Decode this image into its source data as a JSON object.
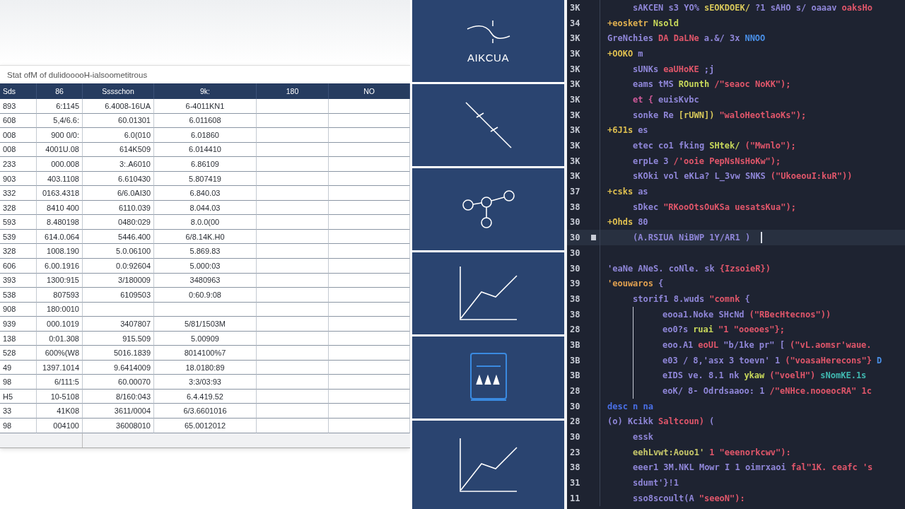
{
  "spreadsheet": {
    "title": "Stat ofM of dulidooooH-ialsoometitrous",
    "columns": [
      "Sds",
      "86",
      "Sssschon",
      "9k:",
      "180",
      "NO"
    ],
    "rows": [
      {
        "cells": [
          "893",
          "6:1145",
          "6.4008-16UA",
          "6-4011KN1"
        ]
      },
      {
        "cells": [
          "608",
          "5,4/6.6:",
          "60.01301",
          "6.011608"
        ]
      },
      {
        "cells": [
          "008",
          "900 0/0:",
          "6.0(010",
          "6.01860"
        ]
      },
      {
        "cells": [
          "008",
          "4001U.08",
          "614K509",
          "6.014410"
        ]
      },
      {
        "cells": [
          "233",
          "000.008",
          "3:.A6010",
          "6.86109"
        ]
      },
      {
        "cells": [
          "903",
          "403.1108",
          "6.610430",
          "5.807419"
        ]
      },
      {
        "cells": [
          "332",
          "0163.4318",
          "6/6.0AI30",
          "6.840.03"
        ]
      },
      {
        "cells": [
          "328",
          "8410 400",
          "6110.039",
          "8.044.03"
        ]
      },
      {
        "cells": [
          "593",
          "8.480198",
          "0480:029",
          "8.0.0(00"
        ]
      },
      {
        "cells": [
          "539",
          "614.0.064",
          "5446.400",
          "6/8.14K.H0"
        ]
      },
      {
        "cells": [
          "328",
          "1008.190",
          "5.0.06100",
          "5.869.83"
        ]
      },
      {
        "cells": [
          "606",
          "6.00.1916",
          "0.0:92604",
          "5.000:03"
        ]
      },
      {
        "cells": [
          "393",
          "1300:915",
          "3/180009",
          "3480963"
        ]
      },
      {
        "cells": [
          "538",
          "807593",
          "6109503",
          "0:60.9:08"
        ]
      },
      {
        "cells": [
          "908",
          "180:0010"
        ]
      },
      {
        "cells": [
          "939",
          "000.1019",
          "3407807",
          "5/81/1503M"
        ]
      },
      {
        "cells": [
          "138",
          "0:01.308",
          "915.509",
          "5.00909"
        ]
      },
      {
        "cells": [
          "528",
          "600%(W8",
          "5016.1839",
          "8014100%7"
        ]
      },
      {
        "cells": [
          "49",
          "1397.1014",
          "9.6414009",
          "18.0180:89"
        ]
      },
      {
        "cells": [
          "98",
          "6/111:5",
          "60.00070",
          "3:3/03:93"
        ]
      },
      {
        "cells": [
          "H5",
          "10-5108",
          "8/160:043",
          "6.4.419.52"
        ]
      },
      {
        "cells": [
          "33",
          "41K08",
          "3611/0004",
          "6/3.6601016"
        ]
      },
      {
        "cells": [
          "98",
          "004100",
          "36008010",
          "65.0012012"
        ]
      }
    ]
  },
  "tiles": [
    {
      "kind": "wave",
      "label": "AIKCUA"
    },
    {
      "kind": "ruler"
    },
    {
      "kind": "nodes"
    },
    {
      "kind": "chart"
    },
    {
      "kind": "server"
    },
    {
      "kind": "chart"
    }
  ],
  "editor": {
    "lines": [
      {
        "number": "3K",
        "kind": "block",
        "current": false,
        "tokens": [
          {
            "text": "sAKCEN s3 YO%",
            "color": "#8f86d8"
          },
          {
            "text": "sEOKDOEK/",
            "color": "#d8c85a"
          },
          {
            "text": "?1 sAHO s/ oaaav",
            "color": "#8f86d8"
          },
          {
            "text": "oaksHo",
            "color": "#e0566a"
          }
        ]
      },
      {
        "number": "34",
        "kind": "root",
        "current": false,
        "tokens": [
          {
            "text": "+eosketr",
            "color": "#e0b050"
          },
          {
            "text": "Nsold",
            "color": "#c8d85a"
          }
        ]
      },
      {
        "number": "3K",
        "kind": "root",
        "current": false,
        "tokens": [
          {
            "text": "GreNchies",
            "color": "#8f86d8"
          },
          {
            "text": "DA DaLNe",
            "color": "#e0566a"
          },
          {
            "text": "a.&/ 3x",
            "color": "#8f86d8"
          },
          {
            "text": "NNOO",
            "color": "#4a90e8"
          }
        ]
      },
      {
        "number": "3K",
        "kind": "root",
        "current": false,
        "tokens": [
          {
            "text": "+OOKO",
            "color": "#e0c050"
          },
          {
            "text": "m",
            "color": "#8f86d8"
          }
        ]
      },
      {
        "number": "3K",
        "kind": "block",
        "current": false,
        "tokens": [
          {
            "text": "sUNKs",
            "color": "#8f86d8"
          },
          {
            "text": "eaUHoKE",
            "color": "#e0566a"
          },
          {
            "text": ";j",
            "color": "#8f86d8"
          }
        ]
      },
      {
        "number": "3K",
        "kind": "block",
        "current": false,
        "tokens": [
          {
            "text": "eams tMS",
            "color": "#8f86d8"
          },
          {
            "text": "ROunth",
            "color": "#c8d85a"
          },
          {
            "text": "/\"seaoc NoKK\");",
            "color": "#e0566a"
          }
        ]
      },
      {
        "number": "3K",
        "kind": "block",
        "current": false,
        "tokens": [
          {
            "text": "et {",
            "color": "#d05a9a"
          },
          {
            "text": "euisKvbc",
            "color": "#8f86d8"
          }
        ]
      },
      {
        "number": "3K",
        "kind": "block",
        "current": false,
        "tokens": [
          {
            "text": "sonke Re",
            "color": "#8f86d8"
          },
          {
            "text": "[rUWN])",
            "color": "#d8c85a"
          },
          {
            "text": "\"waloHeotlaoKs\");",
            "color": "#e0566a"
          }
        ]
      },
      {
        "number": "3K",
        "kind": "root",
        "current": false,
        "tokens": [
          {
            "text": "+6J1s",
            "color": "#e0c050"
          },
          {
            "text": "es",
            "color": "#8f86d8"
          }
        ]
      },
      {
        "number": "3K",
        "kind": "block",
        "current": false,
        "tokens": [
          {
            "text": "etec co1 fking",
            "color": "#8f86d8"
          },
          {
            "text": "SHtek/",
            "color": "#c8d85a"
          },
          {
            "text": "(\"Mwnlo\");",
            "color": "#e0566a"
          }
        ]
      },
      {
        "number": "3K",
        "kind": "block",
        "current": false,
        "tokens": [
          {
            "text": "erpLe 3",
            "color": "#8f86d8"
          },
          {
            "text": "/'ooie PepNsNsHoKw\");",
            "color": "#e0566a"
          }
        ]
      },
      {
        "number": "3K",
        "kind": "block",
        "current": false,
        "tokens": [
          {
            "text": "sKOki vol eKLa? L_3vw SNKS",
            "color": "#8f86d8"
          },
          {
            "text": "(\"UkoeouI:kuR\"))",
            "color": "#e0566a"
          }
        ]
      },
      {
        "number": "37",
        "kind": "root",
        "current": false,
        "tokens": [
          {
            "text": "+csks",
            "color": "#e0c050"
          },
          {
            "text": "as",
            "color": "#8f86d8"
          }
        ]
      },
      {
        "number": "38",
        "kind": "block",
        "current": false,
        "tokens": [
          {
            "text": "sDkec",
            "color": "#8f86d8"
          },
          {
            "text": "\"RKooOtsOuKSa uesatsKua\");",
            "color": "#e0566a"
          }
        ]
      },
      {
        "number": "30",
        "kind": "root",
        "current": false,
        "tokens": [
          {
            "text": "+Ohds",
            "color": "#e0c050"
          },
          {
            "text": "80",
            "color": "#8f86d8"
          }
        ]
      },
      {
        "number": "30",
        "kind": "block",
        "current": true,
        "tokens": [
          {
            "text": "(A.RSIUA NiBWP 1Y/AR1 )",
            "color": "#8f86d8"
          }
        ]
      },
      {
        "number": "30",
        "kind": "root",
        "current": false
      },
      {
        "number": "30",
        "kind": "root",
        "current": false,
        "tokens": [
          {
            "text": "'eaNe ANeS. coNle. sk",
            "color": "#8f86d8"
          },
          {
            "text": "{IzsoieR})",
            "color": "#e0566a"
          }
        ]
      },
      {
        "number": "39",
        "kind": "root",
        "current": false,
        "tokens": [
          {
            "text": "'eouwaros",
            "color": "#e0a050"
          },
          {
            "text": "{",
            "color": "#8f86d8"
          }
        ]
      },
      {
        "number": "38",
        "kind": "block",
        "current": false,
        "tokens": [
          {
            "text": "storif1 8.wuds",
            "color": "#8f86d8"
          },
          {
            "text": "\"comnk",
            "color": "#e0566a"
          },
          {
            "text": "{",
            "color": "#8f86d8"
          }
        ]
      },
      {
        "number": "38",
        "kind": "nested",
        "current": false,
        "tokens": [
          {
            "text": "eooa1.Noke SHcNd",
            "color": "#8f86d8"
          },
          {
            "text": "(\"RBecHtecnos\"))",
            "color": "#e0566a"
          }
        ]
      },
      {
        "number": "28",
        "kind": "nested",
        "current": false,
        "tokens": [
          {
            "text": "eo0?s",
            "color": "#8f86d8"
          },
          {
            "text": "ruai",
            "color": "#c8d85a"
          },
          {
            "text": "\"1 \"ooeoes\"};",
            "color": "#e0566a"
          }
        ]
      },
      {
        "number": "3B",
        "kind": "nested",
        "current": false,
        "tokens": [
          {
            "text": "eoo.A1",
            "color": "#8f86d8"
          },
          {
            "text": "eoUL",
            "color": "#e0566a"
          },
          {
            "text": "\"b/1ke pr\" [",
            "color": "#8f86d8"
          },
          {
            "text": "(\"vL.aomsr'waue.",
            "color": "#e0566a"
          }
        ]
      },
      {
        "number": "3B",
        "kind": "nested",
        "current": false,
        "tokens": [
          {
            "text": "e03 / 8,'asx 3 toevn' 1",
            "color": "#8f86d8"
          },
          {
            "text": "(\"voasaHerecons\"}",
            "color": "#e0566a"
          },
          {
            "text": "D",
            "color": "#4a90e8"
          }
        ]
      },
      {
        "number": "3B",
        "kind": "nested",
        "current": false,
        "tokens": [
          {
            "text": "eIDS ve. 8.1 nk",
            "color": "#8f86d8"
          },
          {
            "text": "ykaw",
            "color": "#c8d85a"
          },
          {
            "text": "(\"voelH\")",
            "color": "#e0566a"
          },
          {
            "text": "sNomKE.1s",
            "color": "#40b8b0"
          }
        ]
      },
      {
        "number": "28",
        "kind": "nested",
        "current": false,
        "tokens": [
          {
            "text": "eoK/ 8- Odrdsaaoo: 1",
            "color": "#8f86d8"
          },
          {
            "text": "/\"eNHce.nooeocRA\" 1c",
            "color": "#e0566a"
          }
        ]
      },
      {
        "number": "30",
        "kind": "root",
        "current": false,
        "tokens": [
          {
            "text": "desc n na",
            "color": "#4a70e8"
          }
        ]
      },
      {
        "number": "28",
        "kind": "root",
        "current": false,
        "tokens": [
          {
            "text": "(o) Kcikk",
            "color": "#8f86d8"
          },
          {
            "text": "Saltcoun)",
            "color": "#e0566a"
          },
          {
            "text": "(",
            "color": "#8f86d8"
          }
        ]
      },
      {
        "number": "30",
        "kind": "block",
        "current": false,
        "tokens": [
          {
            "text": "essk",
            "color": "#8f86d8"
          }
        ]
      },
      {
        "number": "23",
        "kind": "block",
        "current": false,
        "tokens": [
          {
            "text": "eehLvwt:Aouo1'",
            "color": "#c8c86a"
          },
          {
            "text": "1 \"eeenorkcwv\"):",
            "color": "#e0566a"
          }
        ]
      },
      {
        "number": "38",
        "kind": "block",
        "current": false,
        "tokens": [
          {
            "text": "eeer1 3M.NKL Mowr I 1 oimrxaoi",
            "color": "#8f86d8"
          },
          {
            "text": "fal\"1K. ceafc 's",
            "color": "#e0566a"
          }
        ]
      },
      {
        "number": "31",
        "kind": "block",
        "current": false,
        "tokens": [
          {
            "text": "sdumt'}!1",
            "color": "#8f86d8"
          }
        ]
      },
      {
        "number": "11",
        "kind": "block",
        "current": false,
        "tokens": [
          {
            "text": "sso8scoult(A",
            "color": "#8f86d8"
          },
          {
            "text": "\"seeoN\"):",
            "color": "#e0566a"
          }
        ]
      }
    ]
  }
}
